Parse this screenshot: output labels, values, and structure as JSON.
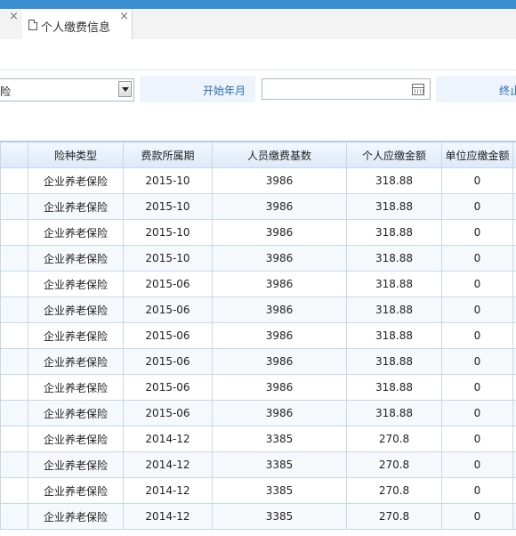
{
  "tabs": [
    {
      "label": "",
      "close": "×"
    },
    {
      "label": "个人缴费信息",
      "close": "×"
    }
  ],
  "filter": {
    "insurance_select_value": "险",
    "start_label": "开始年月",
    "start_value": "",
    "end_label": "终止"
  },
  "table": {
    "columns": [
      "险种类型",
      "费款所属期",
      "人员缴费基数",
      "个人应缴金额",
      "单位应缴金额"
    ],
    "rows": [
      [
        "企业养老保险",
        "2015-10",
        "3986",
        "318.88",
        "0"
      ],
      [
        "企业养老保险",
        "2015-10",
        "3986",
        "318.88",
        "0"
      ],
      [
        "企业养老保险",
        "2015-10",
        "3986",
        "318.88",
        "0"
      ],
      [
        "企业养老保险",
        "2015-10",
        "3986",
        "318.88",
        "0"
      ],
      [
        "企业养老保险",
        "2015-06",
        "3986",
        "318.88",
        "0"
      ],
      [
        "企业养老保险",
        "2015-06",
        "3986",
        "318.88",
        "0"
      ],
      [
        "企业养老保险",
        "2015-06",
        "3986",
        "318.88",
        "0"
      ],
      [
        "企业养老保险",
        "2015-06",
        "3986",
        "318.88",
        "0"
      ],
      [
        "企业养老保险",
        "2015-06",
        "3986",
        "318.88",
        "0"
      ],
      [
        "企业养老保险",
        "2015-06",
        "3986",
        "318.88",
        "0"
      ],
      [
        "企业养老保险",
        "2014-12",
        "3385",
        "270.8",
        "0"
      ],
      [
        "企业养老保险",
        "2014-12",
        "3385",
        "270.8",
        "0"
      ],
      [
        "企业养老保险",
        "2014-12",
        "3385",
        "270.8",
        "0"
      ],
      [
        "企业养老保险",
        "2014-12",
        "3385",
        "270.8",
        "0"
      ]
    ]
  }
}
